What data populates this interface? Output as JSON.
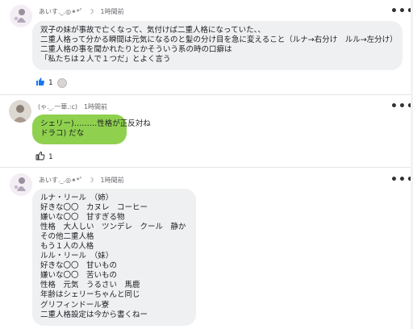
{
  "posts": [
    {
      "author": "あいす._.◎✴︎*゜ ☽",
      "time": "1時間前",
      "lines": [
        "双子の妹が事故で亡くなって、気付けば二重人格になっていた、、",
        "二重人格って分かる瞬間は元気になるのと髪の分け目を急に変えること（ルナ→右分け　ルル→左分け）",
        "二重人格の事を聞かれたりとかそういう系の時の口癖は",
        "「私たちは２人で１つだ」とよく言う"
      ],
      "reaction_count": "1",
      "reaction_icon": "thumbs-up-filled-icon"
    },
    {
      "author": "(ゃ._.一華.:c)",
      "time": "1時間前",
      "lines": [
        "シェリー)………性格が正反対ね",
        "ドラコ) だな"
      ],
      "bubble_color": "#8fd14f",
      "reaction_count": "1",
      "reaction_icon": "thumbs-up-outline-icon"
    },
    {
      "author": "あいす._.◎✴︎*゜ ☽",
      "time": "1時間前",
      "lines": [
        "ルナ・リール　（姉）",
        "好きな〇〇　カヌレ　コーヒー",
        "嫌いな〇〇　甘すぎる物",
        "性格　大人しい　ツンデレ　クール　静か",
        "その他二重人格",
        "もう１人の人格",
        "ルル・リール　（妹）",
        "好きな〇〇　甘いもの",
        "嫌いな〇〇　苦いもの",
        "性格　元気　うるさい　馬鹿",
        "年齢はシェリーちゃんと同じ",
        "グリフィンドール寮",
        "二重人格設定は今から書くねー"
      ]
    }
  ],
  "more_label": "•••"
}
